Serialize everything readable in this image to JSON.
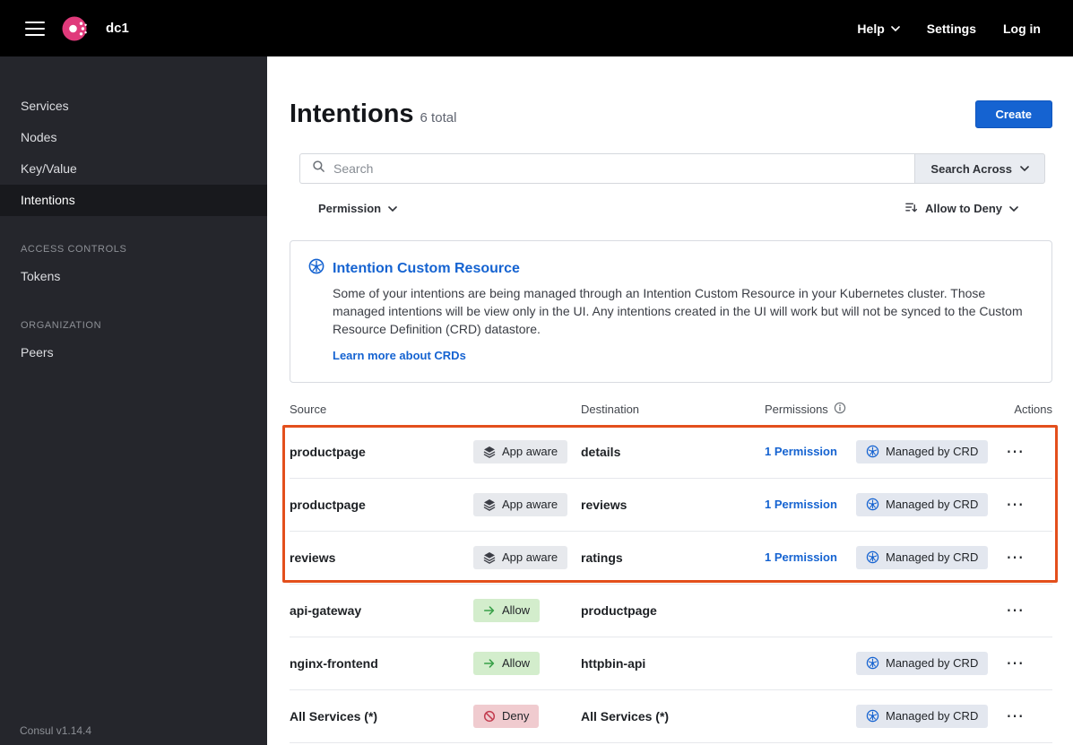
{
  "topbar": {
    "datacenter": "dc1",
    "help": "Help",
    "settings": "Settings",
    "login": "Log in"
  },
  "sidebar": {
    "items": [
      {
        "label": "Services"
      },
      {
        "label": "Nodes"
      },
      {
        "label": "Key/Value"
      },
      {
        "label": "Intentions",
        "active": true
      }
    ],
    "sections": [
      {
        "title": "ACCESS CONTROLS",
        "items": [
          "Tokens"
        ]
      },
      {
        "title": "ORGANIZATION",
        "items": [
          "Peers"
        ]
      }
    ],
    "version": "Consul v1.14.4"
  },
  "header": {
    "title": "Intentions",
    "count": "6 total",
    "create_label": "Create"
  },
  "search": {
    "placeholder": "Search",
    "search_across_label": "Search Across"
  },
  "filters": {
    "permission_label": "Permission",
    "sort_label": "Allow to Deny"
  },
  "banner": {
    "title": "Intention Custom Resource",
    "body": "Some of your intentions are being managed through an Intention Custom Resource in your Kubernetes cluster. Those managed intentions will be view only in the UI. Any intentions created in the UI will work but will not be synced to the Custom Resource Definition (CRD) datastore.",
    "link": "Learn more about CRDs"
  },
  "table": {
    "columns": [
      "Source",
      "Destination",
      "Permissions",
      "Actions"
    ],
    "rows": [
      {
        "source": "productpage",
        "badge": "App aware",
        "badge_type": "app-aware",
        "destination": "details",
        "permissions": "1 Permission",
        "crd": "Managed by CRD",
        "highlighted": true
      },
      {
        "source": "productpage",
        "badge": "App aware",
        "badge_type": "app-aware",
        "destination": "reviews",
        "permissions": "1 Permission",
        "crd": "Managed by CRD",
        "highlighted": true
      },
      {
        "source": "reviews",
        "badge": "App aware",
        "badge_type": "app-aware",
        "destination": "ratings",
        "permissions": "1 Permission",
        "crd": "Managed by CRD",
        "highlighted": true
      },
      {
        "source": "api-gateway",
        "badge": "Allow",
        "badge_type": "allow",
        "destination": "productpage",
        "permissions": "",
        "crd": "",
        "highlighted": false
      },
      {
        "source": "nginx-frontend",
        "badge": "Allow",
        "badge_type": "allow",
        "destination": "httpbin-api",
        "permissions": "",
        "crd": "Managed by CRD",
        "highlighted": false
      },
      {
        "source": "All Services (*)",
        "badge": "Deny",
        "badge_type": "deny",
        "destination": "All Services (*)",
        "permissions": "",
        "crd": "Managed by CRD",
        "highlighted": false
      }
    ]
  },
  "icons": {
    "menu": "hamburger-icon",
    "logo": "consul-logo",
    "search": "search-icon",
    "chevron": "chevron-down-icon",
    "sort": "sort-icon",
    "info": "info-icon",
    "kubernetes": "kubernetes-icon",
    "app_aware": "layers-icon",
    "allow": "arrow-right-icon",
    "deny": "deny-circle-icon",
    "more": "more-actions-icon"
  },
  "colors": {
    "accent_blue": "#1563d1",
    "brand_pink": "#e03a7b",
    "topbar_bg": "#000000",
    "sidebar_bg": "#25262c",
    "allow_badge_bg": "#d3edcc",
    "allow_icon": "#38a048",
    "deny_badge_bg": "#f0cbcf",
    "deny_icon": "#c23b4e",
    "neutral_badge_bg": "#e7e9ed",
    "crd_badge_bg": "#e3e7ef",
    "highlight_border": "#e34f1c"
  }
}
